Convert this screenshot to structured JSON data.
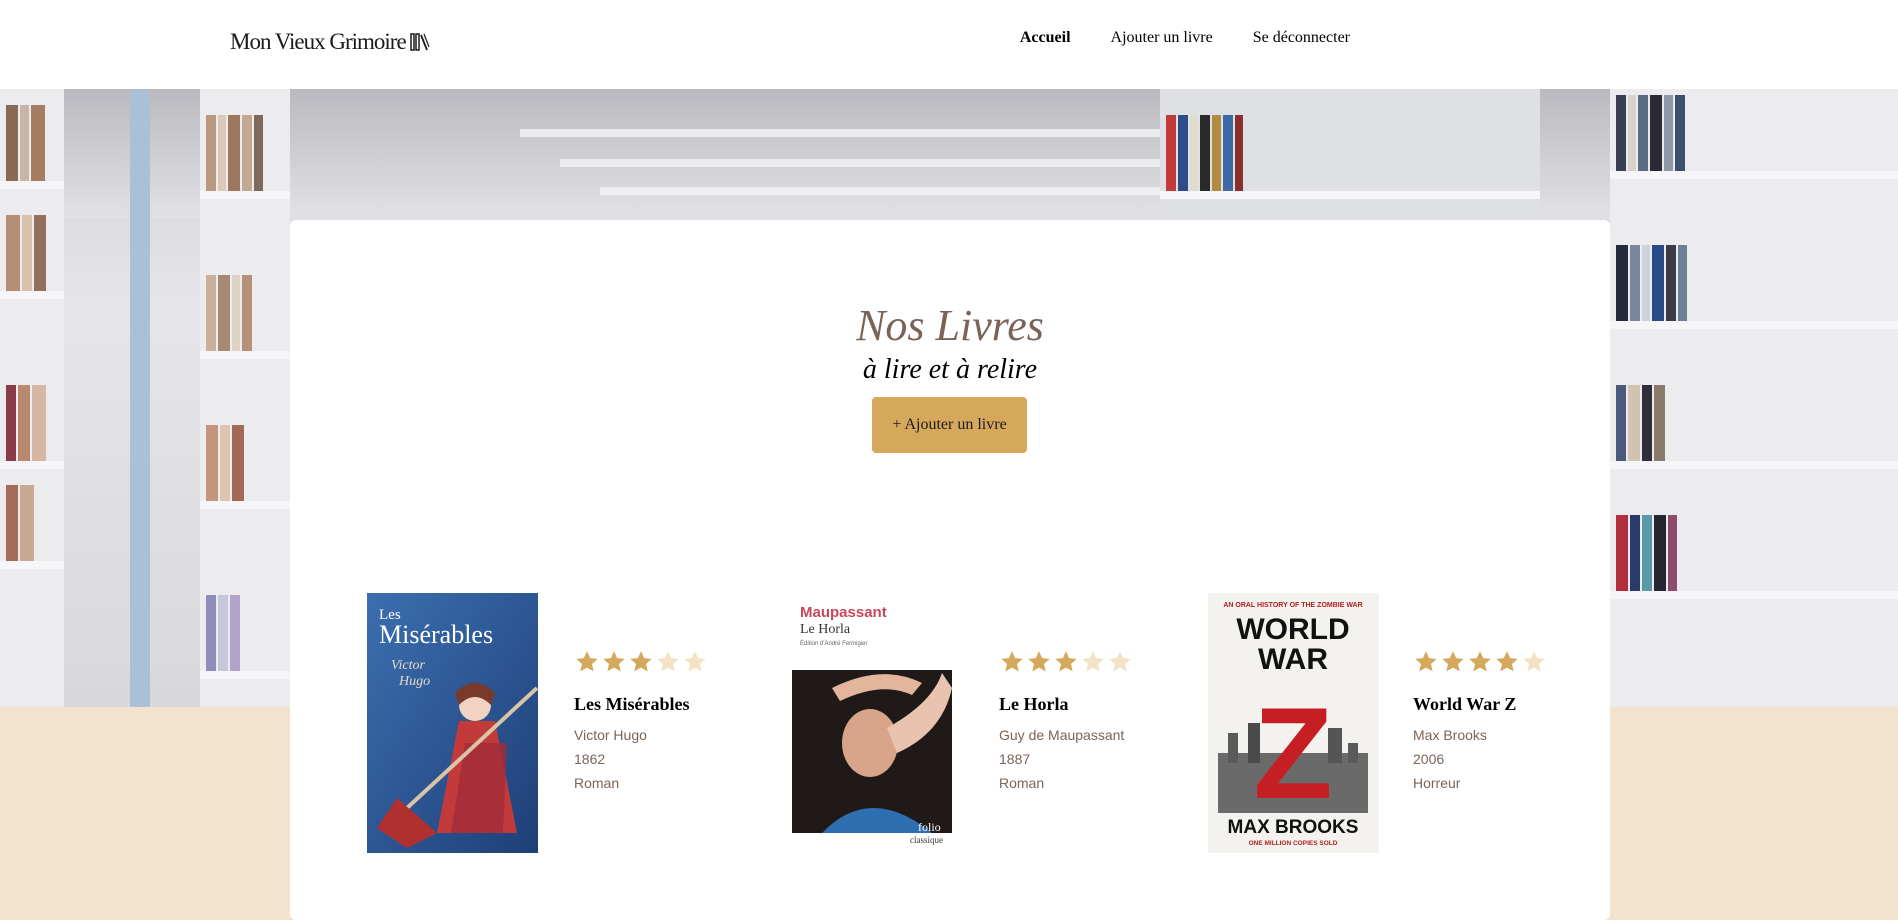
{
  "header": {
    "logo_text": "Mon Vieux Grimoire",
    "logo_icon": "books-icon",
    "nav": [
      {
        "label": "Accueil",
        "active": true
      },
      {
        "label": "Ajouter un livre",
        "active": false
      },
      {
        "label": "Se déconnecter",
        "active": false
      }
    ]
  },
  "main": {
    "title": "Nos Livres",
    "subtitle": "à lire et à relire",
    "add_button_label": "+ Ajouter un livre"
  },
  "books": [
    {
      "title": "Les Misérables",
      "author": "Victor Hugo",
      "year": "1862",
      "genre": "Roman",
      "rating": 3,
      "cover_text": {
        "line1": "Les",
        "line2": "Misérables",
        "line3": "Victor",
        "line4": "Hugo"
      }
    },
    {
      "title": "Le Horla",
      "author": "Guy de Maupassant",
      "year": "1887",
      "genre": "Roman",
      "rating": 3,
      "cover_text": {
        "line1": "Maupassant",
        "line2": "Le Horla",
        "line3": "Édition d'André Fermigier",
        "line4": "folio",
        "line5": "classique"
      }
    },
    {
      "title": "World War Z",
      "author": "Max Brooks",
      "year": "2006",
      "genre": "Horreur",
      "rating": 4,
      "cover_text": {
        "line1": "AN ORAL HISTORY OF THE ZOMBIE WAR",
        "line2": "WORLD",
        "line3": "WAR",
        "line4": "Z",
        "line5": "MAX BROOKS",
        "line6": "ONE MILLION COPIES SOLD"
      }
    }
  ],
  "colors": {
    "accent": "#d6a85c",
    "star_filled": "#d6a85c",
    "star_empty": "#f3e2c4",
    "meta_text": "#7a6457",
    "page_bg": "#f2e3cf"
  }
}
